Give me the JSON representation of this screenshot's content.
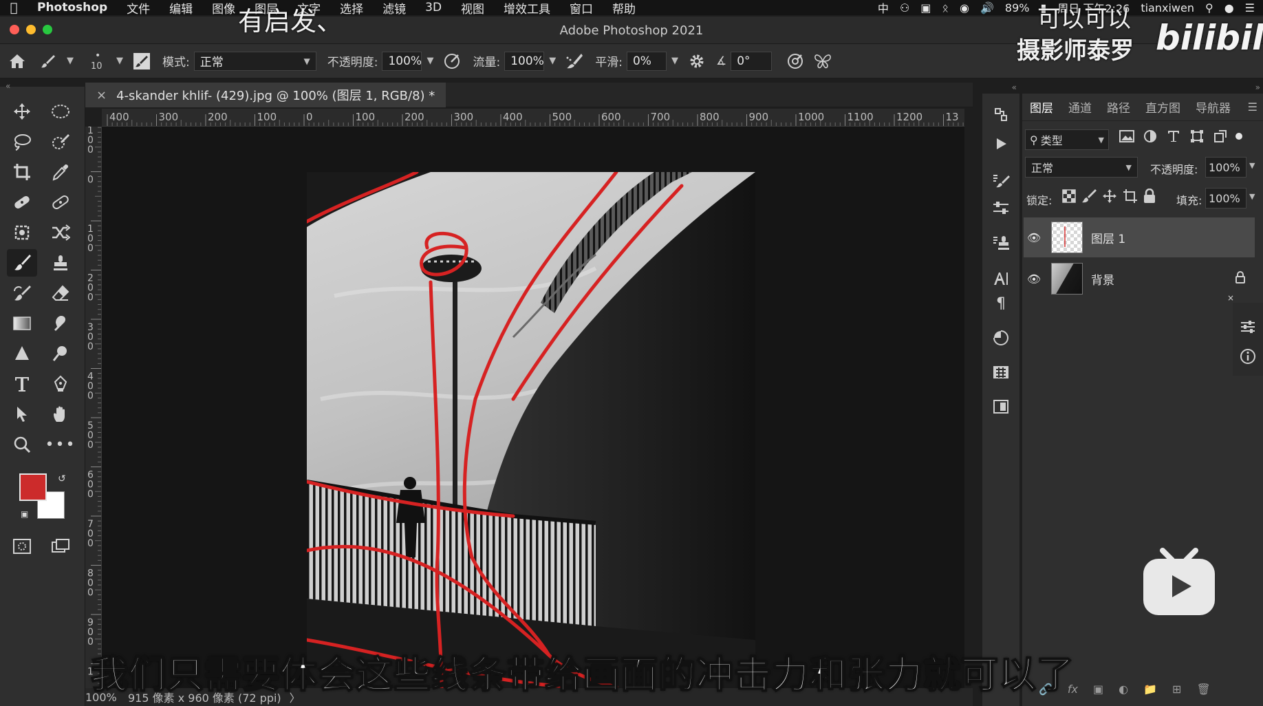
{
  "menubar": {
    "app_name": "Photoshop",
    "items": [
      "文件",
      "编辑",
      "图像",
      "图层",
      "文字",
      "选择",
      "滤镜",
      "3D",
      "视图",
      "增效工具",
      "窗口",
      "帮助"
    ],
    "input_method": "中",
    "battery": "89%",
    "clock": "周日 下午2:26",
    "user": "tianxiwen"
  },
  "window": {
    "title": "Adobe Photoshop 2021"
  },
  "options_bar": {
    "brush_size": "10",
    "mode_label": "模式:",
    "mode_value": "正常",
    "opacity_label": "不透明度:",
    "opacity_value": "100%",
    "flow_label": "流量:",
    "flow_value": "100%",
    "smoothing_label": "平滑:",
    "smoothing_value": "0%",
    "angle_value": "0°"
  },
  "document": {
    "tab_title": "4-skander khlif- (429).jpg @ 100% (图层 1, RGB/8) *",
    "close_glyph": "×",
    "zoom": "100%",
    "dimensions": "915 像素 x 960 像素 (72 ppi)",
    "status_arrow": "〉"
  },
  "rulers": {
    "horizontal": [
      "400",
      "300",
      "200",
      "100",
      "0",
      "100",
      "200",
      "300",
      "400",
      "500",
      "600",
      "700",
      "800",
      "900",
      "1000",
      "1100",
      "1200",
      "13"
    ],
    "vertical": [
      "100",
      "0",
      "100",
      "200",
      "300",
      "400",
      "500",
      "600",
      "700",
      "800",
      "900",
      "1"
    ]
  },
  "colors": {
    "foreground": "#cc2b2b",
    "background": "#ffffff",
    "accent": "#d62222",
    "panel": "#2f2f2f"
  },
  "layers_panel": {
    "tabs": [
      "图层",
      "通道",
      "路径",
      "直方图",
      "导航器"
    ],
    "filter_label": "类型",
    "blend_mode": "正常",
    "opacity_label": "不透明度:",
    "opacity_value": "100%",
    "lock_label": "锁定:",
    "fill_label": "填充:",
    "fill_value": "100%",
    "layers": [
      {
        "name": "图层 1",
        "selected": true
      },
      {
        "name": "背景",
        "selected": false
      }
    ]
  },
  "overlays": {
    "subtitle": "我们只需要体会这些线条带给画面的冲击力和张力就可以了",
    "top_hint": "有启发、",
    "watermark_line1": "可以可以",
    "watermark_line2": "摄影师泰罗",
    "watermark_logo": "bilibili"
  }
}
